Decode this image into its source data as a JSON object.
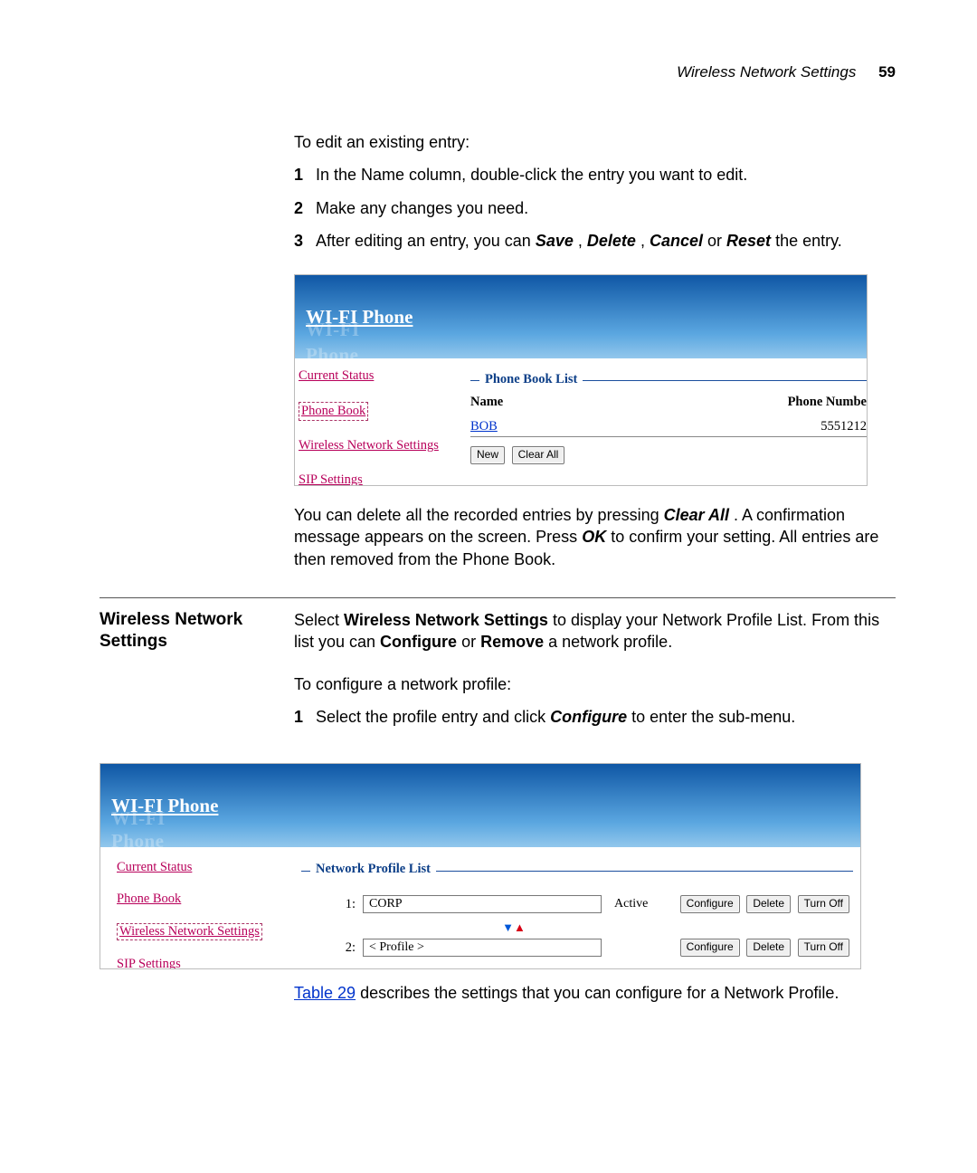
{
  "header": {
    "title": "Wireless Network Settings",
    "page": "59"
  },
  "top": {
    "intro": "To edit an existing entry:",
    "steps": [
      "In the Name column, double-click the entry you want to edit.",
      "Make any changes you need.",
      {
        "pre": "After editing an entry, you can ",
        "s": "Save",
        "c1": ", ",
        "d": "Delete",
        "c2": ", ",
        "ca": "Cancel",
        "c3": " or ",
        "r": "Reset",
        "end": " the entry."
      }
    ]
  },
  "ui_common": {
    "logo": "WI-FI Phone",
    "logo_shadow": "WI-FI Phone"
  },
  "ui1": {
    "nav": {
      "current_status": "Current Status",
      "phone_book": "Phone Book",
      "wns": "Wireless Network Settings",
      "sip": "SIP Settings"
    },
    "group_title": "Phone Book List",
    "col_name": "Name",
    "col_number": "Phone Numbe",
    "row": {
      "name": "BOB",
      "number": "5551212"
    },
    "btn_new": "New",
    "btn_clear": "Clear All"
  },
  "para_after_ui1": {
    "p1a": "You can delete all the recorded entries by pressing ",
    "p1b": "Clear All",
    "p1c": ". A confirmation message appears on the screen. Press ",
    "p1d": "OK",
    "p1e": " to confirm your setting. All entries are then removed from the Phone Book."
  },
  "section2": {
    "heading": "Wireless Network Settings",
    "t1a": "Select ",
    "t1b": "Wireless Network Settings",
    "t1c": " to display your Network Profile List. From this list you can ",
    "t1d": "Configure",
    "t1e": " or ",
    "t1f": "Remove",
    "t1g": " a network profile.",
    "t2": "To configure a network profile:",
    "step1a": "Select the profile entry and click ",
    "step1b": "Configure",
    "step1c": " to enter the sub-menu."
  },
  "ui2": {
    "nav": {
      "current_status": "Current Status",
      "phone_book": "Phone Book",
      "wns": "Wireless Network Settings",
      "sip": "SIP Settings"
    },
    "group_title": "Network Profile List",
    "rows": [
      {
        "idx": "1:",
        "name": "CORP",
        "status": "Active"
      },
      {
        "idx": "2:",
        "name": "< Profile >",
        "status": ""
      }
    ],
    "btn_cfg": "Configure",
    "btn_del": "Delete",
    "btn_off": "Turn Off"
  },
  "tail": {
    "link": "Table 29",
    "rest": " describes the settings that you can configure for a Network Profile."
  }
}
